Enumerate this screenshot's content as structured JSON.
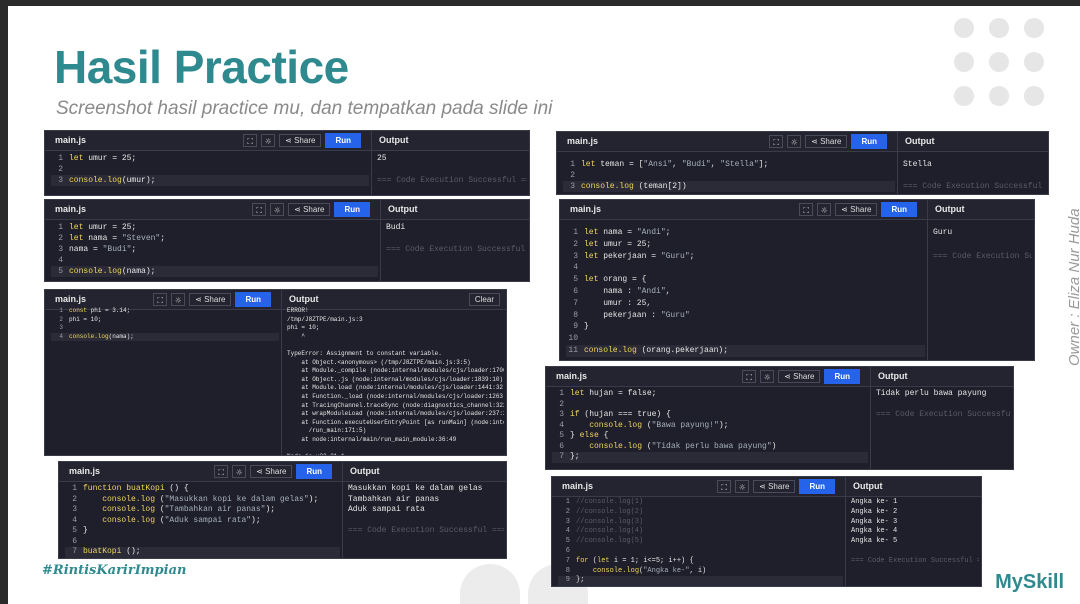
{
  "slide": {
    "title": "Hasil Practice",
    "subtitle": "Screenshot hasil practice mu, dan tempatkan pada slide ini",
    "hashtag": "#RintisKarirImpian",
    "logo": "MySkill",
    "owner": "Owner : Eliza Nur Huda"
  },
  "editor": {
    "file": "main.js",
    "share": "Share",
    "run": "Run",
    "output_label": "Output",
    "clear": "Clear",
    "success": "=== Code Execution Successful ==="
  },
  "panels": {
    "p1": {
      "lines": [
        "let umur = 25;",
        "",
        "console.log(umur);"
      ],
      "output": [
        "25"
      ]
    },
    "p2": {
      "lines": [
        "let umur = 25;",
        "let nama = \"Steven\";",
        "nama = \"Budi\";",
        "",
        "console.log(nama);"
      ],
      "output": [
        "Budi"
      ]
    },
    "p3": {
      "lines": [
        "const phi = 3.14;",
        "phi = 10;",
        "",
        "console.log(nama);"
      ],
      "output": [
        "ERROR!",
        "/tmp/J8ZTPE/main.js:3",
        "phi = 10;",
        "    ^",
        "",
        "TypeError: Assignment to constant variable.",
        "    at Object.<anonymous> (/tmp/J8ZTPE/main.js:3:5)",
        "    at Module._compile (node:internal/modules/cjs/loader:1706:14)",
        "    at Object..js (node:internal/modules/cjs/loader:1839:10)",
        "    at Module.load (node:internal/modules/cjs/loader:1441:32)",
        "    at Function._load (node:internal/modules/cjs/loader:1263:12)",
        "    at TracingChannel.traceSync (node:diagnostics_channel:322:14)",
        "    at wrapModuleLoad (node:internal/modules/cjs/loader:237:24)",
        "    at Function.executeUserEntryPoint [as runMain] (node:internal/modules",
        "      /run_main:171:5)",
        "    at node:internal/main/run_main_module:36:49",
        "",
        "Node.js v22.21.1",
        "",
        "=== Code Exited With Errors ==="
      ]
    },
    "p4": {
      "lines": [
        "function buatKopi () {",
        "    console.log (\"Masukkan kopi ke dalam gelas\");",
        "    console.log (\"Tambahkan air panas\");",
        "    console.log (\"Aduk sampai rata\");",
        "}",
        "",
        "buatKopi ();"
      ],
      "output": [
        "Masukkan kopi ke dalam gelas",
        "Tambahkan air panas",
        "Aduk sampai rata"
      ]
    },
    "p5": {
      "lines": [
        "let teman = [\"Ansi\", \"Budi\", \"Stella\"];",
        "",
        "console.log (teman[2])"
      ],
      "output": [
        "Stella"
      ]
    },
    "p6": {
      "lines": [
        "let nama = \"Andi\";",
        "let umur = 25;",
        "let pekerjaan = \"Guru\";",
        "",
        "let orang = {",
        "    nama : \"Andi\",",
        "    umur : 25,",
        "    pekerjaan : \"Guru\"",
        "}",
        "",
        "console.log (orang.pekerjaan);"
      ],
      "output": [
        "Guru"
      ]
    },
    "p7": {
      "lines": [
        "let hujan = false;",
        "",
        "if (hujan === true) {",
        "    console.log (\"Bawa payung!\");",
        "} else {",
        "    console.log (\"Tidak perlu bawa payung\")",
        "};"
      ],
      "output": [
        "Tidak perlu bawa payung"
      ]
    },
    "p8": {
      "lines": [
        "//console.log(1)",
        "//console.log(2)",
        "//console.log(3)",
        "//console.log(4)",
        "//console.log(5)",
        "",
        "for (let i = 1; i<=5; i++) {",
        "    console.log(\"Angka ke-\", i)",
        "};"
      ],
      "output": [
        "Angka ke- 1",
        "Angka ke- 2",
        "Angka ke- 3",
        "Angka ke- 4",
        "Angka ke- 5"
      ]
    }
  }
}
